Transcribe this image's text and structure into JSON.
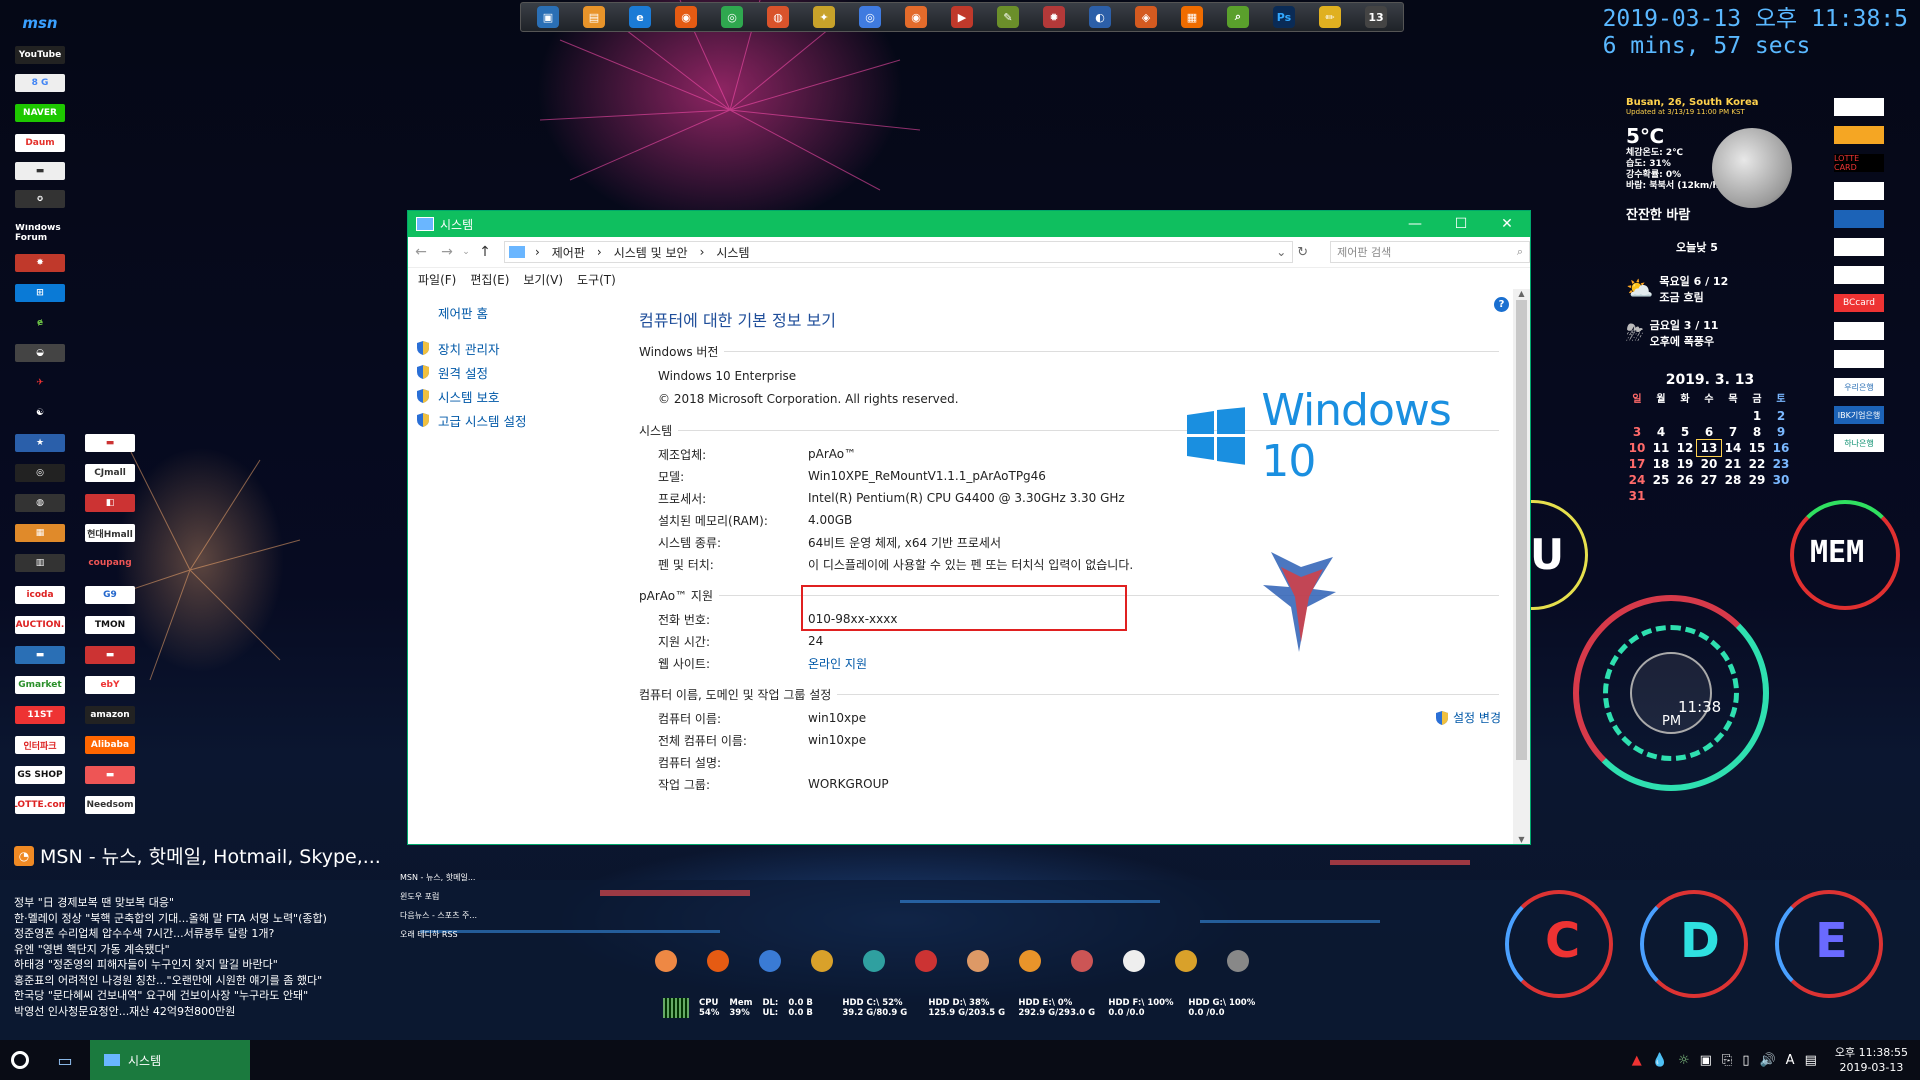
{
  "clock_widget": {
    "datetime": "2019-03-13 오후 11:38:5",
    "uptime": "6 mins, 57 secs"
  },
  "weather": {
    "location": "Busan, 26, South Korea",
    "updated": "Updated at 3/13/19 11:00 PM KST",
    "temp": "5℃",
    "feels": "체감온도: 2℃",
    "humidity": "습도: 31%",
    "precip": "강수확률: 0%",
    "wind": "바람: 북북서 (12km/h)",
    "summary": "잔잔한 바람",
    "today": "오늘낮 5",
    "day1": "목요일 6 / 12",
    "day1_desc": "조금 흐림",
    "day2": "금요일 3 / 11",
    "day2_desc": "오후에 폭풍우"
  },
  "calendar": {
    "title": "2019. 3. 13",
    "weekdays": [
      "일",
      "월",
      "화",
      "수",
      "목",
      "금",
      "토"
    ],
    "weeks": [
      [
        "",
        "",
        "",
        "",
        "",
        "1",
        "2"
      ],
      [
        "3",
        "4",
        "5",
        "6",
        "7",
        "8",
        "9"
      ],
      [
        "10",
        "11",
        "12",
        "13",
        "14",
        "15",
        "16"
      ],
      [
        "17",
        "18",
        "19",
        "20",
        "21",
        "22",
        "23"
      ],
      [
        "24",
        "25",
        "26",
        "27",
        "28",
        "29",
        "30"
      ],
      [
        "31",
        "",
        "",
        "",
        "",
        "",
        ""
      ]
    ]
  },
  "gauges": {
    "left_label": "U",
    "mem_label": "MEM",
    "center_time": "11:38",
    "center_ampm": "PM",
    "drive_c": "C",
    "drive_d": "D",
    "drive_e": "E"
  },
  "left_icons": {
    "msn": "msn",
    "youtube": "YouTube",
    "naver": "NAVER",
    "daum": "Daum",
    "windows_forum": "Windows Forum",
    "icoda": "icoda",
    "auction": "AUCTION.",
    "tmon": "TMON",
    "gmarket": "Gmarket",
    "ebay": "ebY",
    "amazon": "amazon",
    "gsshop": "GS SHOP",
    "lotte": "LOTTE.com",
    "cjmall": "CJmall",
    "hmall": "현대Hmall",
    "coupang": "coupang",
    "needsom": "Needsom"
  },
  "right_icons": {
    "lottecard": "LOTTE CARD",
    "bccard": "BCcard",
    "ibk": "IBK기업은행",
    "hana": "하나은행",
    "woori": "우리은행"
  },
  "news": {
    "title": "MSN - 뉴스, 핫메일, Hotmail, Skype,...",
    "items": [
      "정부 \"日 경제보복 땐 맞보복 대응\"",
      "한·멜레이 정상 \"북핵 군축합의 기대...올해 말 FTA 서명 노력\"(종합)",
      "정준영폰 수리업체 압수수색 7시간...서류봉투 달랑 1개?",
      "유엔 \"영변 핵단지 가동 계속됐다\"",
      "하태경 \"정준영의 피해자들이 누구인지 찾지 말길 바란다\"",
      "홍준표의 어려적인 나경원 칭찬...\"오랜만에 시원한 얘기를 좀 했다\"",
      "한국당 \"문다혜씨 건보내역\" 요구에 건보이사장 \"누구라도 안돼\"",
      "박영선 인사청문요청안...재산 42억9천800만원"
    ],
    "side_links": [
      "MSN - 뉴스, 핫메일...",
      "윈도우 포럼",
      "다음뉴스 - 스포츠 주...",
      "오래 테디하 RSS"
    ]
  },
  "sysmon": {
    "cpu": "CPU",
    "cpu_val": "54%",
    "mem": "Mem",
    "mem_val": "39%",
    "dl": "DL:",
    "dl_val": "0.0 B",
    "ul": "UL:",
    "ul_val": "0.0 B",
    "hdd_c": "HDD C:\\ 52%",
    "hdd_c_sz": "39.2 G/80.9 G",
    "hdd_d": "HDD D:\\ 38%",
    "hdd_d_sz": "125.9 G/203.5 G",
    "hdd_e": "HDD E:\\ 0%",
    "hdd_e_sz": "292.9 G/293.0 G",
    "hdd_f": "HDD F:\\ 100%",
    "hdd_f_sz": "0.0 /0.0",
    "hdd_g": "HDD G:\\ 100%",
    "hdd_g_sz": "0.0 /0.0"
  },
  "window": {
    "title": "시스템",
    "breadcrumb": [
      "제어판",
      "시스템 및 보안",
      "시스템"
    ],
    "search_placeholder": "제어판 검색",
    "menu": [
      "파일(F)",
      "편집(E)",
      "보기(V)",
      "도구(T)"
    ],
    "sidebar_home": "제어판 홈",
    "sidebar_links": [
      "장치 관리자",
      "원격 설정",
      "시스템 보호",
      "고급 시스템 설정"
    ],
    "heading": "컴퓨터에 대한 기본 정보 보기",
    "sec_windows": "Windows 버전",
    "edition": "Windows 10 Enterprise",
    "copyright": "© 2018 Microsoft Corporation. All rights reserved.",
    "win_logo_text": "Windows 10",
    "sec_system": "시스템",
    "system_rows": [
      {
        "k": "제조업체:",
        "v": "pArAo™"
      },
      {
        "k": "모델:",
        "v": "Win10XPE_ReMountV1.1.1_pArAoTPg46"
      },
      {
        "k": "프로세서:",
        "v": "Intel(R) Pentium(R) CPU G4400 @ 3.30GHz   3.30 GHz"
      },
      {
        "k": "설치된 메모리(RAM):",
        "v": "4.00GB"
      },
      {
        "k": "시스템 종류:",
        "v": "64비트 운영 체제, x64 기반 프로세서"
      },
      {
        "k": "펜 및 터치:",
        "v": "이 디스플레이에 사용할 수 있는 펜 또는 터치식 입력이 없습니다."
      }
    ],
    "sec_support": "pArAo™ 지원",
    "support_rows": [
      {
        "k": "전화 번호:",
        "v": "010-98xx-xxxx"
      },
      {
        "k": "지원 시간:",
        "v": "24"
      },
      {
        "k": "웹 사이트:",
        "v": "온라인 지원"
      }
    ],
    "sec_computer": "컴퓨터 이름, 도메인 및 작업 그룹 설정",
    "change_settings": "설정 변경",
    "computer_rows": [
      {
        "k": "컴퓨터 이름:",
        "v": "win10xpe"
      },
      {
        "k": "전체 컴퓨터 이름:",
        "v": "win10xpe"
      },
      {
        "k": "컴퓨터 설명:",
        "v": ""
      },
      {
        "k": "작업 그룹:",
        "v": "WORKGROUP"
      }
    ]
  },
  "taskbar": {
    "task_label": "시스템",
    "tray_time": "오후 11:38:55",
    "tray_date": "2019-03-13",
    "ime": "A"
  },
  "colors": {
    "titlebar": "#0fbf5f",
    "link": "#0058a8",
    "heading": "#1f4e9a",
    "highlight_box": "#e02020",
    "clock": "#5ab8ff"
  }
}
